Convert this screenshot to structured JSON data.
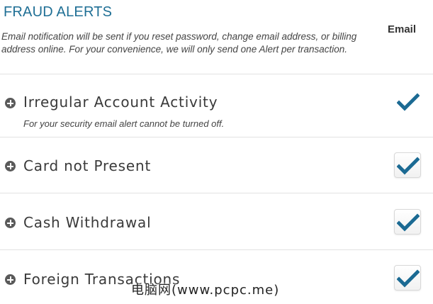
{
  "header": {
    "title": "FRAUD ALERTS",
    "column_label": "Email",
    "description": "Email notification will be sent if you reset password, change email address, or billing address online. For your convenience, we will only send one Alert per transaction."
  },
  "alerts": [
    {
      "label": "Irregular Account Activity",
      "note": "For your security email alert cannot be turned off.",
      "checked": true,
      "locked": true
    },
    {
      "label": "Card not Present",
      "note": "",
      "checked": true,
      "locked": false
    },
    {
      "label": "Cash Withdrawal",
      "note": "",
      "checked": true,
      "locked": false
    },
    {
      "label": "Foreign Transactions",
      "note": "",
      "checked": true,
      "locked": false
    }
  ],
  "watermark": "电脑网(www.pcpc.me)",
  "colors": {
    "title": "#1f6f95",
    "checkmark": "#1b6a93",
    "expand_icon": "#5a5a5a"
  }
}
